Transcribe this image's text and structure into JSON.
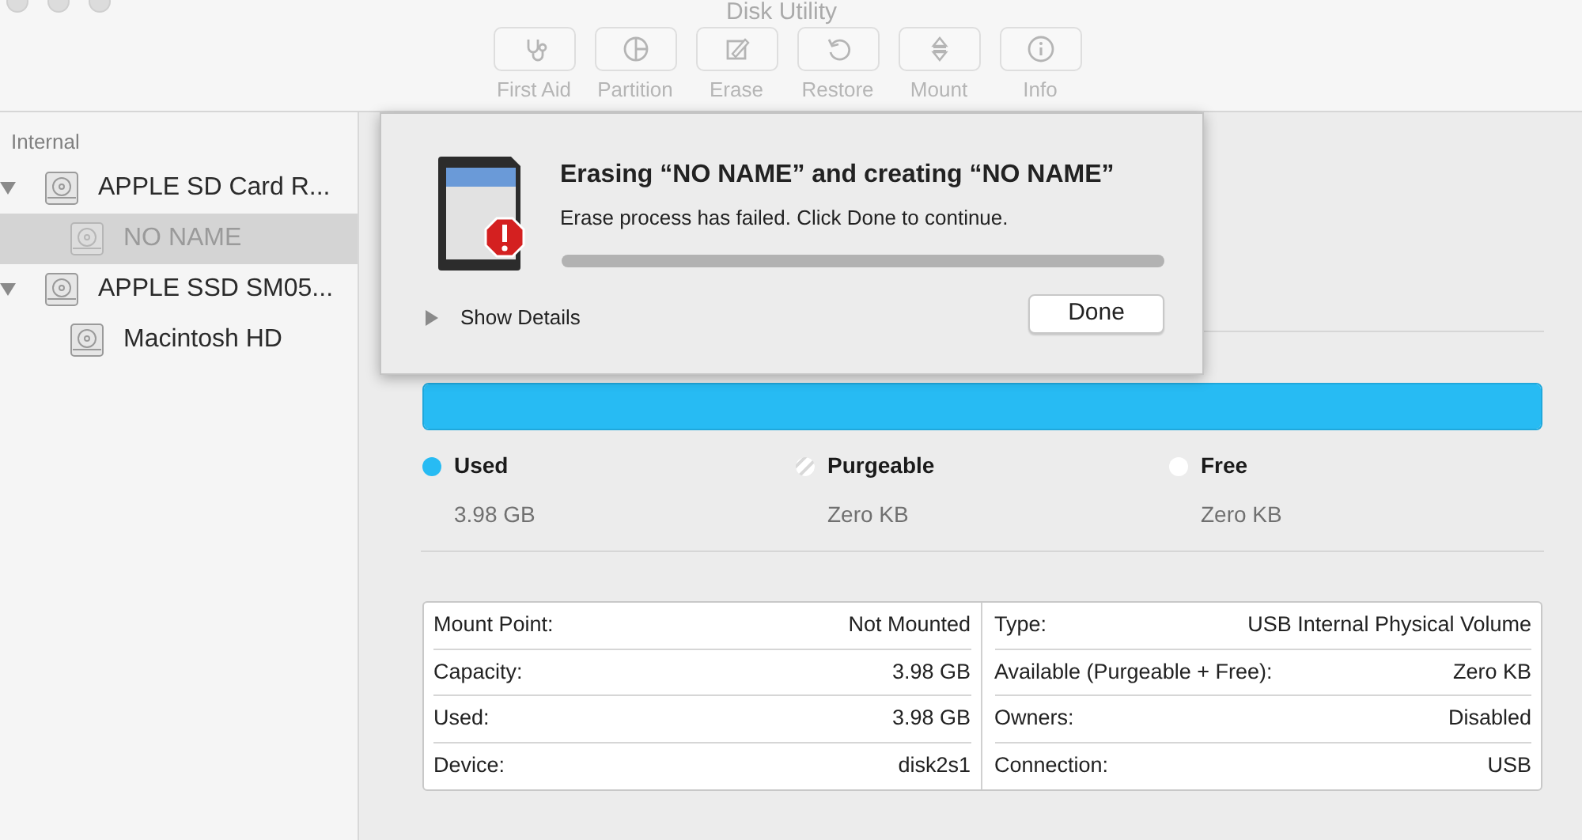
{
  "window": {
    "title": "Disk Utility"
  },
  "toolbar": [
    {
      "label": "First Aid",
      "kind": "stethoscope"
    },
    {
      "label": "Partition",
      "kind": "pie"
    },
    {
      "label": "Erase",
      "kind": "erase"
    },
    {
      "label": "Restore",
      "kind": "restore"
    },
    {
      "label": "Mount",
      "kind": "mount"
    },
    {
      "label": "Info",
      "kind": "info"
    }
  ],
  "sidebar": {
    "section": "Internal",
    "items": [
      {
        "label": "APPLE SD Card R...",
        "expanded": true,
        "selected": false,
        "dimmed": false,
        "children": [
          {
            "label": "NO NAME",
            "selected": true,
            "dimmed": true
          }
        ]
      },
      {
        "label": "APPLE SSD SM05...",
        "expanded": true,
        "selected": false,
        "dimmed": false,
        "children": [
          {
            "label": "Macintosh HD",
            "selected": false,
            "dimmed": false
          }
        ]
      }
    ]
  },
  "usage": {
    "level": 1.0,
    "legend": [
      {
        "label": "Used",
        "value": "3.98 GB",
        "color": "#27bbf3",
        "kind": "solid"
      },
      {
        "label": "Purgeable",
        "value": "Zero KB",
        "color": "#ffffff",
        "kind": "hatched"
      },
      {
        "label": "Free",
        "value": "Zero KB",
        "color": "#ffffff",
        "kind": "solid"
      }
    ]
  },
  "info_table": {
    "rows": [
      [
        {
          "label": "Mount Point:",
          "value": "Not Mounted"
        },
        {
          "label": "Type:",
          "value": "USB Internal Physical Volume"
        }
      ],
      [
        {
          "label": "Capacity:",
          "value": "3.98 GB"
        },
        {
          "label": "Available (Purgeable + Free):",
          "value": "Zero KB"
        }
      ],
      [
        {
          "label": "Used:",
          "value": "3.98 GB"
        },
        {
          "label": "Owners:",
          "value": "Disabled"
        }
      ],
      [
        {
          "label": "Device:",
          "value": "disk2s1"
        },
        {
          "label": "Connection:",
          "value": "USB"
        }
      ]
    ]
  },
  "dialog": {
    "title": "Erasing “NO NAME” and creating “NO NAME”",
    "message": "Erase process has failed. Click Done to continue.",
    "details_toggle": "Show Details",
    "details_expanded": false,
    "button": "Done"
  }
}
